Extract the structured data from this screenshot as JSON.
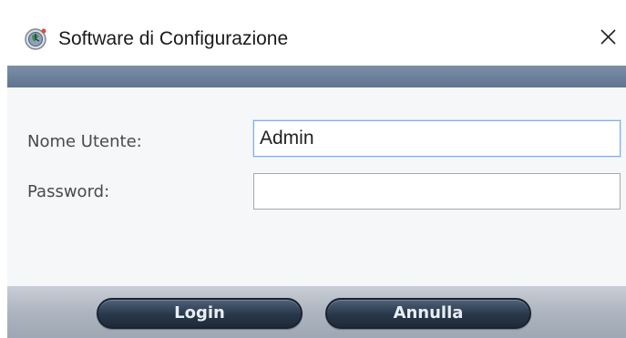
{
  "window": {
    "title": "Software di Configurazione",
    "icon": "globe-clock-icon",
    "close_icon": "close-icon"
  },
  "form": {
    "username_label": "Nome Utente:",
    "username_value": "Admin",
    "password_label": "Password:",
    "password_value": ""
  },
  "buttons": {
    "login_label": "Login",
    "cancel_label": "Annulla"
  },
  "colors": {
    "header_band": "#6b7f99",
    "button_dark": "#283749",
    "footer": "#b3bac4",
    "input_focus_border": "#7faee6"
  }
}
